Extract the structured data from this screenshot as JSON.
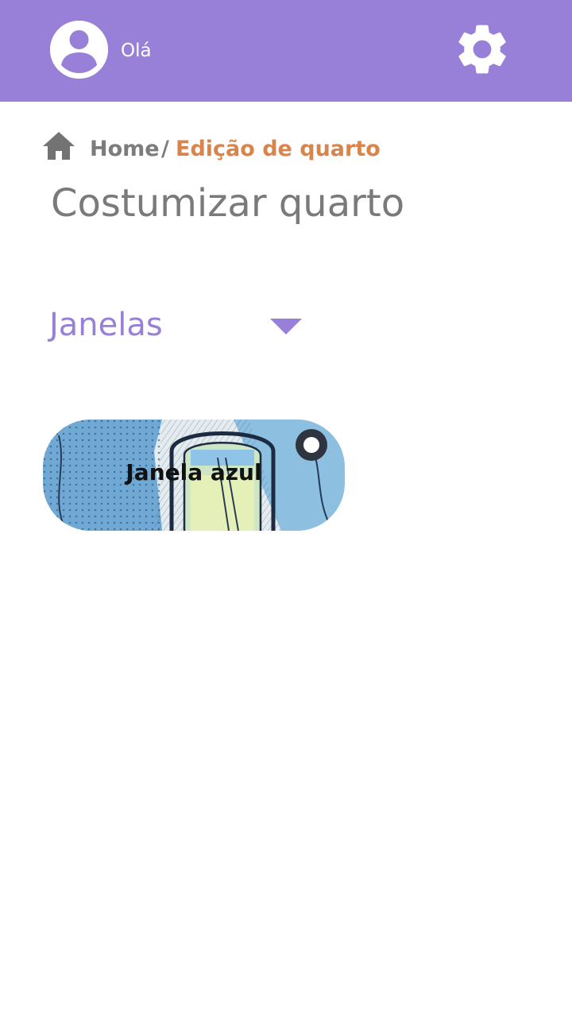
{
  "header": {
    "greeting": "Olá",
    "avatar_icon": "account-circle-icon",
    "settings_icon": "gear-icon",
    "background_color": "#9880d8"
  },
  "breadcrumb": {
    "home_icon": "home-icon",
    "home_label": "Home",
    "separator": "/",
    "current_label": "Edição de quarto",
    "current_color": "#d9844a"
  },
  "page": {
    "title": "Costumizar quarto"
  },
  "category_select": {
    "selected": "Janelas",
    "arrow_icon": "caret-down-icon",
    "accent_color": "#9880d8"
  },
  "items": [
    {
      "label": "Janela azul",
      "selected": true
    }
  ]
}
